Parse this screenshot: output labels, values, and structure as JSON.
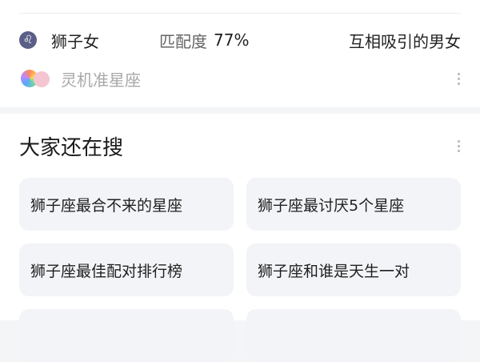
{
  "match": {
    "zodiac_icon": "leo-icon",
    "zodiac_glyph": "♌",
    "name": "狮子女",
    "score_label": "匹配度",
    "score_value": "77%",
    "description": "互相吸引的男女"
  },
  "source": {
    "logo": "lingji-logo",
    "name": "灵机准星座"
  },
  "related": {
    "title": "大家还在搜",
    "items": [
      "狮子座最合不来的星座",
      "狮子座最讨厌5个星座",
      "狮子座最佳配对排行榜",
      "狮子座和谁是天生一对"
    ]
  },
  "colors": {
    "background": "#f4f5f7",
    "card": "#ffffff",
    "chip": "#f3f4f7",
    "muted_text": "#a8a8a8",
    "zodiac_badge": "#5b5f86"
  }
}
